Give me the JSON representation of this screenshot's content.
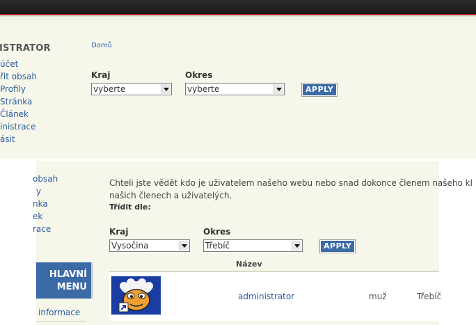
{
  "top_panel": {
    "sidebar_title": "ISTRATOR",
    "sidebar_items": [
      "účet",
      "řit obsah",
      "Profily",
      "Stránka",
      "Článek",
      "inistrace",
      "ásit"
    ],
    "breadcrumb": "Domů",
    "filters": {
      "kraj_label": "Kraj",
      "kraj_value": "vyberte",
      "okres_label": "Okres",
      "okres_value": "vyberte",
      "apply_label": "APPLY"
    }
  },
  "bottom_panel": {
    "sidebar_items": [
      "obsah",
      "y",
      "nka",
      "ek",
      "race"
    ],
    "menu_title_line1": "HLAVNÍ",
    "menu_title_line2": "MENU",
    "menu_item": "informace",
    "intro_line1": "Chteli jste vědět kdo je uživatelem našeho webu nebo snad dokonce členem našeho kl",
    "intro_line2": "našich členech a uživatelých.",
    "sort_label": "Třídit dle:",
    "filters": {
      "kraj_label": "Kraj",
      "kraj_value": "Vysočina",
      "okres_label": "Okres",
      "okres_value": "Třebíč",
      "apply_label": "APPLY"
    },
    "table": {
      "column_header": "Název",
      "rows": [
        {
          "name": "administrator",
          "gender": "muž",
          "city": "Třebíč"
        }
      ]
    }
  },
  "colors": {
    "accent_blue": "#3b6aa5",
    "link_blue": "#2d5c9e",
    "panel_bg": "#f6f7ea",
    "topbar": "#1a1a1a"
  }
}
